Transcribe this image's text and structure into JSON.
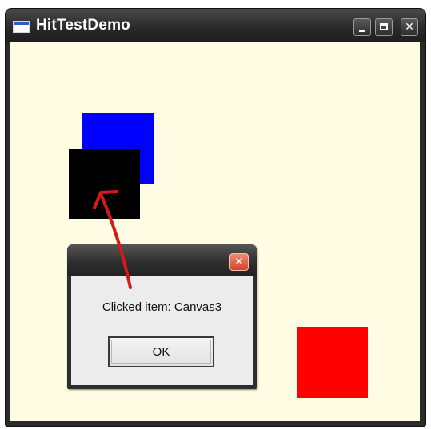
{
  "window": {
    "title": "HitTestDemo",
    "icon": "app-window-icon",
    "buttons": {
      "minimize_icon": "minimize-icon",
      "maximize_icon": "maximize-icon",
      "close_glyph": "✕",
      "close_icon": "close-icon"
    },
    "client_background": "#fffce3"
  },
  "canvas": {
    "squares": [
      {
        "name": "blue-square",
        "color": "#0000ff"
      },
      {
        "name": "black-square",
        "color": "#000000"
      },
      {
        "name": "red-square",
        "color": "#ff0000"
      }
    ]
  },
  "dialog": {
    "title": "",
    "close_glyph": "✕",
    "message": "Clicked item: Canvas3",
    "ok_label": "OK"
  },
  "annotation": {
    "arrow_color": "#d61a1a"
  }
}
